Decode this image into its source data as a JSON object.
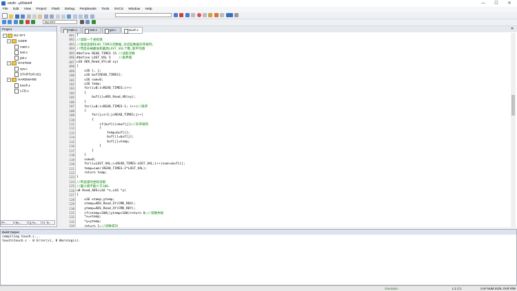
{
  "window": {
    "title": "ceshi - µVision4",
    "minimize": "—",
    "maximize": "☐",
    "close": "✕"
  },
  "menu": [
    "File",
    "Edit",
    "View",
    "Project",
    "Flash",
    "Debug",
    "Peripherals",
    "Tools",
    "SVCS",
    "Window",
    "Help"
  ],
  "toolbar": {
    "target": "RX-TFT"
  },
  "project": {
    "header": "Project",
    "root": "RX-TFT",
    "groups": [
      {
        "name": "USER",
        "files": [
          "main.c",
          "test.c",
          "gui.c"
        ]
      },
      {
        "name": "SYSTEM",
        "files": [
          "sys.c",
          "STARTUP.A51"
        ]
      },
      {
        "name": "HARDWARE",
        "files": [
          "touch.c",
          "LCD.c"
        ]
      }
    ],
    "tabs": [
      "Pr...",
      "Bo...",
      "{} Fu...",
      "0. Te..."
    ]
  },
  "editor": {
    "tabs": [
      "main.c",
      "test.c",
      "gui.c",
      "touch.c"
    ],
    "active_tab": 3,
    "lines": [
      {
        "n": "091",
        "t": "}"
      },
      {
        "n": "092",
        "t": "//读取一个坐标值"
      },
      {
        "n": "093",
        "t": "//连续读取READ_TIMES次数据,对这些数据升序排列,"
      },
      {
        "n": "094",
        "t": "//然后去掉最低和最高LOST_VAL个数,取平均值"
      },
      {
        "n": "095",
        "t": "#define READ_TIMES 15 //读取次数"
      },
      {
        "n": "096",
        "t": "#define LOST_VAL 5    //丢弃值"
      },
      {
        "n": "097",
        "t": "u16 ADS_Read_XY(u8 xy)"
      },
      {
        "n": "098",
        "t": "{"
      },
      {
        "n": "099",
        "t": "    u16 i, j;"
      },
      {
        "n": "100",
        "t": "    u16 buf[READ_TIMES];"
      },
      {
        "n": "101",
        "t": "    u16 sum=0;"
      },
      {
        "n": "102",
        "t": "    u16 temp;"
      },
      {
        "n": "103",
        "t": "    for(i=0;i<READ_TIMES;i++)"
      },
      {
        "n": "104",
        "t": "    {"
      },
      {
        "n": "105",
        "t": "        buf[i]=ADS_Read_AD(xy);"
      },
      {
        "n": "106",
        "t": "    }"
      },
      {
        "n": "107",
        "t": "    for(i=0;i<READ_TIMES-1; i++)//排序"
      },
      {
        "n": "108",
        "t": "    {"
      },
      {
        "n": "109",
        "t": "        for(j=i+1;j<READ_TIMES;j++)"
      },
      {
        "n": "110",
        "t": "        {"
      },
      {
        "n": "111",
        "t": "            if(buf[i]>buf[j])//升序排列"
      },
      {
        "n": "112",
        "t": "            {"
      },
      {
        "n": "113",
        "t": "                temp=buf[i];"
      },
      {
        "n": "114",
        "t": "                buf[i]=buf[j];"
      },
      {
        "n": "115",
        "t": "                buf[j]=temp;"
      },
      {
        "n": "116",
        "t": "            }"
      },
      {
        "n": "117",
        "t": "        }"
      },
      {
        "n": "118",
        "t": "    }"
      },
      {
        "n": "119",
        "t": "    sum=0;"
      },
      {
        "n": "120",
        "t": "    for(i=LOST_VAL;i<READ_TIMES-LOST_VAL;i++)sum+=buf[i];"
      },
      {
        "n": "121",
        "t": "    temp=sum/(READ_TIMES-2*LOST_VAL);"
      },
      {
        "n": "122",
        "t": "    return temp;"
      },
      {
        "n": "123",
        "t": "}"
      },
      {
        "n": "124",
        "t": "//带滤波的坐标读取"
      },
      {
        "n": "125",
        "t": "//最小值不能少于100."
      },
      {
        "n": "126",
        "t": "u8 Read_ADS(u16 *x,u16 *y)"
      },
      {
        "n": "127",
        "t": "{"
      },
      {
        "n": "128",
        "t": "    u16 xtemp,ytemp;"
      },
      {
        "n": "129",
        "t": "    xtemp=ADS_Read_XY(CMD_RDX);"
      },
      {
        "n": "130",
        "t": "    ytemp=ADS_Read_XY(CMD_RDY);"
      },
      {
        "n": "131",
        "t": "    if(xtemp<100||ytemp<100)return 0;//读数失败"
      },
      {
        "n": "132",
        "t": "    *x=xtemp;"
      },
      {
        "n": "133",
        "t": "    *y=ytemp;"
      },
      {
        "n": "134",
        "t": "    return 1;//读数成功"
      }
    ]
  },
  "build": {
    "header": "Build Output",
    "lines": [
      "compiling touch.c...",
      "touch\\touch.c - 0 Error(s), 0 Warning(s)."
    ]
  },
  "status": {
    "mode": "Simulation",
    "cursor": "L:1 C:1",
    "indicators": "CAP  NUM  SCRL  OVR  R/W"
  }
}
